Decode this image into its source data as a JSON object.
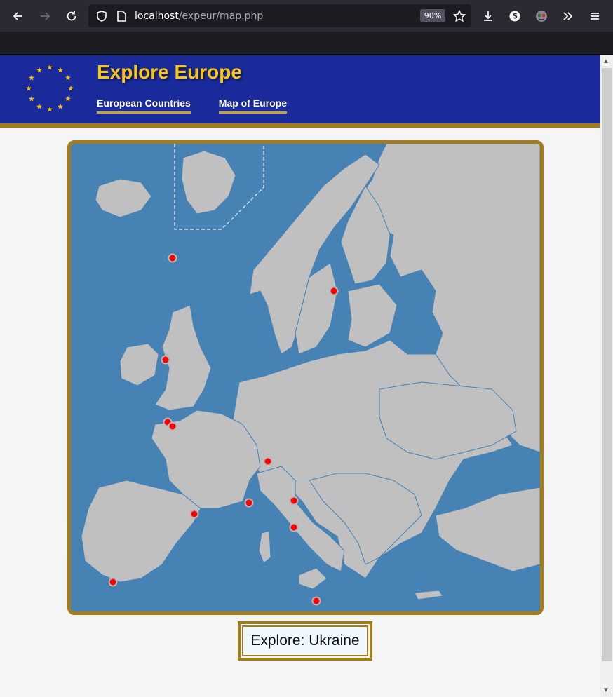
{
  "browser": {
    "url_host": "localhost",
    "url_path": "/expeur/map.php",
    "zoom": "90%"
  },
  "header": {
    "title": "Explore Europe",
    "nav": [
      "European Countries",
      "Map of Europe"
    ]
  },
  "explore": {
    "label": "Explore: Ukraine"
  },
  "colors": {
    "header_bg": "#1a2a9a",
    "title": "#f5c518",
    "gold": "#a37d1c",
    "sea": "#4682b4",
    "land": "#c0c0c0",
    "marker": "#ff0000"
  },
  "icons": [
    "back-icon",
    "forward-icon",
    "reload-icon",
    "shield-icon",
    "page-icon",
    "star-icon",
    "download-icon",
    "extension-icon",
    "account-icon",
    "overflow-icon",
    "menu-icon"
  ]
}
